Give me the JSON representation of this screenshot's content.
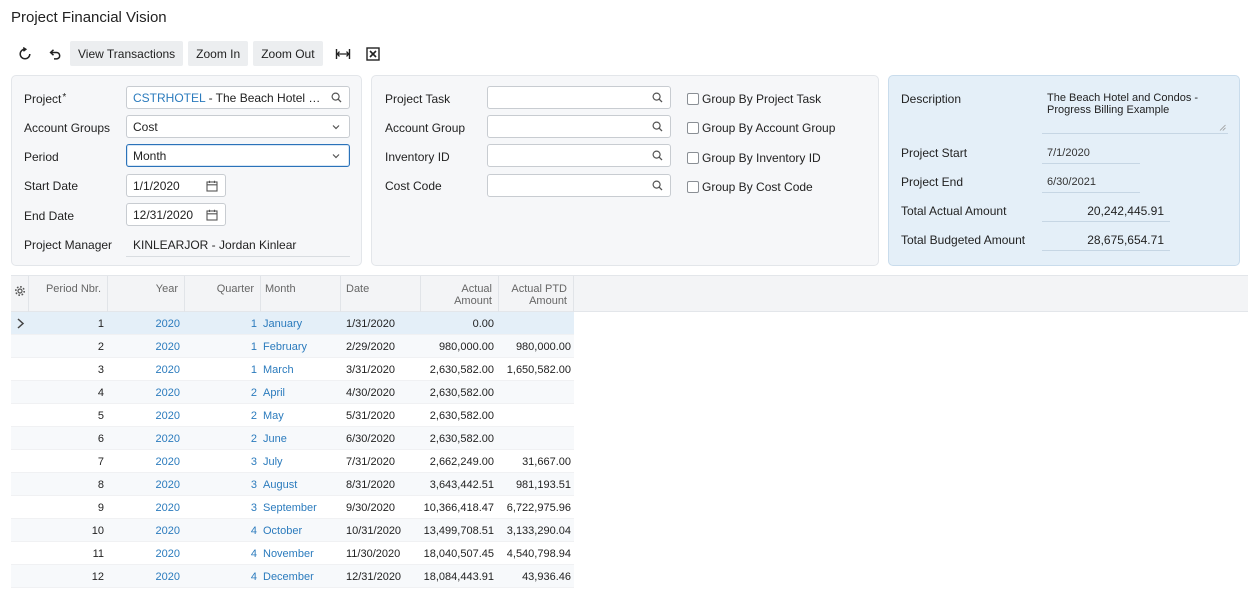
{
  "page": {
    "title": "Project Financial Vision"
  },
  "toolbar": {
    "refresh_icon": "refresh-icon",
    "undo_icon": "undo-icon",
    "view_transactions": "View Transactions",
    "zoom_in": "Zoom In",
    "zoom_out": "Zoom Out",
    "fit_icon": "fit-to-width-icon",
    "excel_icon": "export-excel-icon"
  },
  "left_panel": {
    "project_label": "Project",
    "required_mark": "*",
    "project_code": "CSTRHOTEL",
    "project_name": " - The Beach Hotel and ...",
    "account_groups_label": "Account Groups",
    "account_groups_value": "Cost",
    "period_label": "Period",
    "period_value": "Month",
    "start_date_label": "Start Date",
    "start_date_value": "1/1/2020",
    "end_date_label": "End Date",
    "end_date_value": "12/31/2020",
    "project_manager_label": "Project Manager",
    "project_manager_value": "KINLEARJOR - Jordan Kinlear"
  },
  "mid_panel": {
    "project_task_label": "Project Task",
    "project_task_value": "",
    "account_group_label": "Account Group",
    "account_group_value": "",
    "inventory_id_label": "Inventory ID",
    "inventory_id_value": "",
    "cost_code_label": "Cost Code",
    "cost_code_value": "",
    "group_by_project_task": "Group By Project Task",
    "group_by_account_group": "Group By Account Group",
    "group_by_inventory_id": "Group By Inventory ID",
    "group_by_cost_code": "Group By Cost Code"
  },
  "right_panel": {
    "description_label": "Description",
    "description_value": "The Beach Hotel and Condos - Progress Billing Example",
    "project_start_label": "Project Start",
    "project_start_value": "7/1/2020",
    "project_end_label": "Project End",
    "project_end_value": "6/30/2021",
    "total_actual_label": "Total Actual Amount",
    "total_actual_value": "20,242,445.91",
    "total_budgeted_label": "Total Budgeted Amount",
    "total_budgeted_value": "28,675,654.71"
  },
  "grid": {
    "settings_icon": "gear-icon",
    "columns": {
      "period_nbr": "Period Nbr.",
      "year": "Year",
      "quarter": "Quarter",
      "month": "Month",
      "date": "Date",
      "actual_amount_1": "Actual",
      "actual_amount_2": "Amount",
      "actual_ptd_1": "Actual PTD",
      "actual_ptd_2": "Amount"
    },
    "rows": [
      {
        "period": "1",
        "year": "2020",
        "quarter": "1",
        "month": "January",
        "date": "1/31/2020",
        "actual": "0.00",
        "ptd": ""
      },
      {
        "period": "2",
        "year": "2020",
        "quarter": "1",
        "month": "February",
        "date": "2/29/2020",
        "actual": "980,000.00",
        "ptd": "980,000.00"
      },
      {
        "period": "3",
        "year": "2020",
        "quarter": "1",
        "month": "March",
        "date": "3/31/2020",
        "actual": "2,630,582.00",
        "ptd": "1,650,582.00"
      },
      {
        "period": "4",
        "year": "2020",
        "quarter": "2",
        "month": "April",
        "date": "4/30/2020",
        "actual": "2,630,582.00",
        "ptd": ""
      },
      {
        "period": "5",
        "year": "2020",
        "quarter": "2",
        "month": "May",
        "date": "5/31/2020",
        "actual": "2,630,582.00",
        "ptd": ""
      },
      {
        "period": "6",
        "year": "2020",
        "quarter": "2",
        "month": "June",
        "date": "6/30/2020",
        "actual": "2,630,582.00",
        "ptd": ""
      },
      {
        "period": "7",
        "year": "2020",
        "quarter": "3",
        "month": "July",
        "date": "7/31/2020",
        "actual": "2,662,249.00",
        "ptd": "31,667.00"
      },
      {
        "period": "8",
        "year": "2020",
        "quarter": "3",
        "month": "August",
        "date": "8/31/2020",
        "actual": "3,643,442.51",
        "ptd": "981,193.51"
      },
      {
        "period": "9",
        "year": "2020",
        "quarter": "3",
        "month": "September",
        "date": "9/30/2020",
        "actual": "10,366,418.47",
        "ptd": "6,722,975.96"
      },
      {
        "period": "10",
        "year": "2020",
        "quarter": "4",
        "month": "October",
        "date": "10/31/2020",
        "actual": "13,499,708.51",
        "ptd": "3,133,290.04"
      },
      {
        "period": "11",
        "year": "2020",
        "quarter": "4",
        "month": "November",
        "date": "11/30/2020",
        "actual": "18,040,507.45",
        "ptd": "4,540,798.94"
      },
      {
        "period": "12",
        "year": "2020",
        "quarter": "4",
        "month": "December",
        "date": "12/31/2020",
        "actual": "18,084,443.91",
        "ptd": "43,936.46"
      }
    ]
  },
  "colors": {
    "accent": "#2b7bbd",
    "focus_border": "#2b72b9",
    "selected_row": "#e4eff8",
    "summary_panel": "#e4eff8"
  }
}
